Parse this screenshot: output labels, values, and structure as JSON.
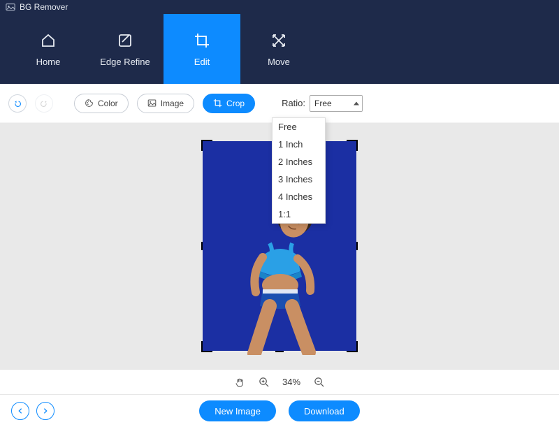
{
  "app": {
    "title": "BG Remover"
  },
  "nav": {
    "items": [
      {
        "label": "Home"
      },
      {
        "label": "Edge Refine"
      },
      {
        "label": "Edit"
      },
      {
        "label": "Move"
      }
    ]
  },
  "toolbar": {
    "color_label": "Color",
    "image_label": "Image",
    "crop_label": "Crop",
    "ratio_label": "Ratio:",
    "ratio_selected": "Free",
    "ratio_options": [
      "Free",
      "1 Inch",
      "2 Inches",
      "3 Inches",
      "4 Inches",
      "1:1"
    ]
  },
  "zoom": {
    "level": "34%"
  },
  "footer": {
    "new_image_label": "New Image",
    "download_label": "Download"
  }
}
